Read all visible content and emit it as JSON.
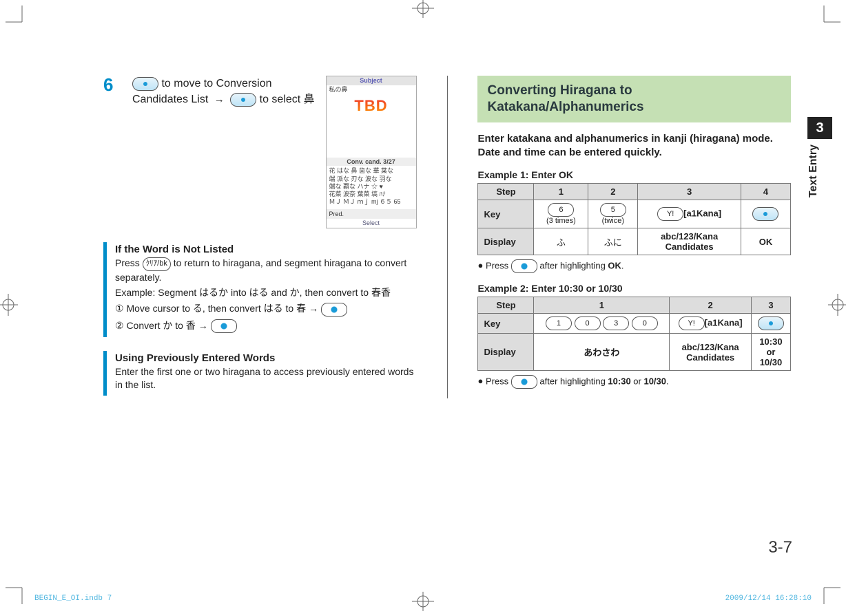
{
  "meta": {
    "chapter_tab_number": "3",
    "chapter_tab_label": "Text Entry",
    "page_number": "3-7",
    "footer_left": "BEGIN_E_OI.indb   7",
    "footer_right": "2009/12/14   16:28:10"
  },
  "left": {
    "step_number": "6",
    "step_text_a": " to move to Conversion Candidates List ",
    "step_text_b": " to select ",
    "step_text_c": "鼻",
    "phone": {
      "title": "Subject",
      "entered": "私の鼻",
      "tbd": "TBD",
      "conv_bar": "Conv.  cand.        3/27",
      "cands_1": "花  はな  鼻  歯な  華  葉な",
      "cands_2": "端  派な  刃な  波な  羽な",
      "cands_3": "端な  覇な  ハナ  ☆  ♥",
      "cands_4": "花菜  波奈  葉菜  塙  ﾊﾅ",
      "cands_5": "ＭＪ  ＭＪ ｍｊ  mj  ６５  65",
      "pred": "Pred.",
      "select": "Select"
    },
    "box1": {
      "heading": "If the Word is Not Listed",
      "p1_a": "Press ",
      "p1_key": "ｸﾘｱ/bk",
      "p1_b": " to return to hiragana, and segment hiragana to convert separately.",
      "p2": "Example: Segment はるか into はる and か, then convert to 春香",
      "p3": "① Move cursor to る, then convert はる to 春 → ",
      "p4": "② Convert か to 香 → "
    },
    "box2": {
      "heading": "Using Previously Entered Words",
      "p1": "Enter the first one or two hiragana to access previously entered words in the list."
    }
  },
  "right": {
    "heading": "Converting Hiragana to Katakana/Alphanumerics",
    "lead": "Enter katakana and alphanumerics in kanji (hiragana) mode. Date and time can be entered quickly.",
    "ex1": {
      "title": "Example 1: Enter OK",
      "headers": [
        "Step",
        "1",
        "2",
        "3",
        "4"
      ],
      "row_key_label": "Key",
      "row_disp_label": "Display",
      "key1_btn": "6",
      "key1_note": "(3 times)",
      "key2_btn": "5",
      "key2_note": "(twice)",
      "key3_btn": "Y!",
      "key3_label": "[a1Kana]",
      "disp1": "ふ",
      "disp2": "ふに",
      "disp3_a": "abc/123/Kana",
      "disp3_b": "Candidates",
      "disp4": "OK",
      "bullet_a": "Press ",
      "bullet_b": " after highlighting ",
      "bullet_c": "OK",
      "bullet_d": "."
    },
    "ex2": {
      "title": "Example 2: Enter 10:30 or 10/30",
      "headers": [
        "Step",
        "1",
        "2",
        "3"
      ],
      "row_key_label": "Key",
      "row_disp_label": "Display",
      "key1_btns": [
        "1",
        "0",
        "3",
        "0"
      ],
      "key2_btn": "Y!",
      "key2_label": "[a1Kana]",
      "disp1": "あわさわ",
      "disp2_a": "abc/123/Kana",
      "disp2_b": "Candidates",
      "disp3_a": "10:30",
      "disp3_b": "or",
      "disp3_c": "10/30",
      "bullet_a": "Press ",
      "bullet_b": " after highlighting ",
      "bullet_c": "10:30",
      "bullet_d": " or ",
      "bullet_e": "10/30",
      "bullet_f": "."
    }
  }
}
